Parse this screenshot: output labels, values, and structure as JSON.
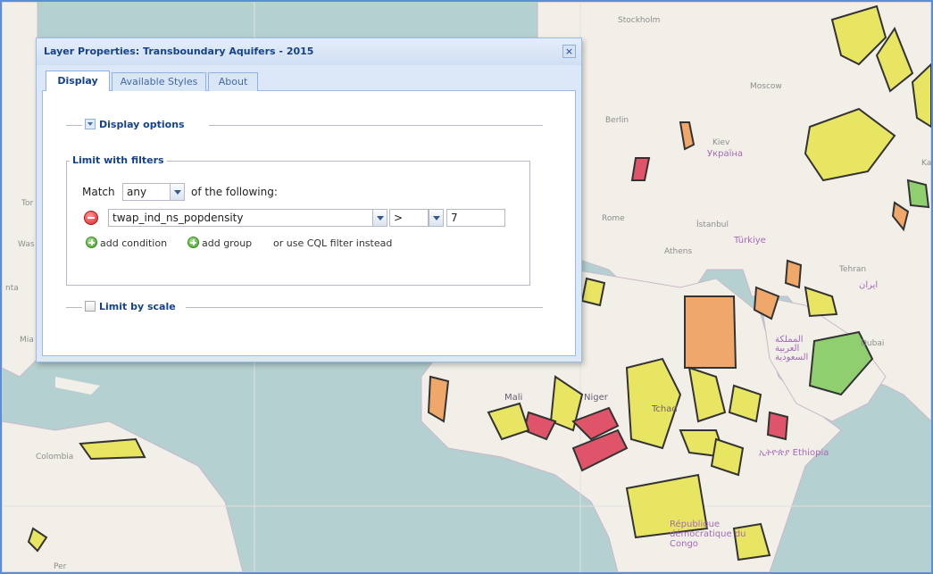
{
  "map": {
    "labels": {
      "stockholm": "Stockholm",
      "moscow": "Moscow",
      "berlin": "Berlin",
      "kiev": "Kiev",
      "ukraine": "Україна",
      "rome": "Rome",
      "istanbul": "İstanbul",
      "athens": "Athens",
      "turkiye": "Türkiye",
      "tehran": "Tehran",
      "iran": "ایران",
      "ka": "Ka",
      "saudi": "المملكة العربية السعودية",
      "dubai": "Dubai",
      "mali": "Mali",
      "niger": "Niger",
      "tchad": "Tchad",
      "ethiopia": "ኢትዮጵያ Ethiopia",
      "colombia": "Colombia",
      "congo": "République démocratique du Congo",
      "tor": "Tor",
      "was": "Was",
      "nta": "nta",
      "mia": "Mia",
      "per": "Per"
    },
    "colors": {
      "land": "#f2efe9",
      "water": "#b5d0d0",
      "yellow": "#e8e563",
      "orange": "#efa86a",
      "red": "#e0546a",
      "green": "#8fcf6f"
    }
  },
  "dialog": {
    "title": "Layer Properties: Transboundary Aquifers - 2015",
    "close_label": "×",
    "tabs": [
      "Display",
      "Available Styles",
      "About"
    ],
    "display_options_label": "Display options",
    "limit_filters": {
      "legend": "Limit with filters",
      "match_prefix": "Match",
      "match_value": "any",
      "match_suffix": "of the following:",
      "condition": {
        "attribute": "twap_ind_ns_popdensity",
        "operator": ">",
        "value": "7"
      },
      "add_condition": "add condition",
      "add_group": "add group",
      "cql_link": "or use CQL filter instead"
    },
    "limit_scale_label": "Limit by scale"
  }
}
